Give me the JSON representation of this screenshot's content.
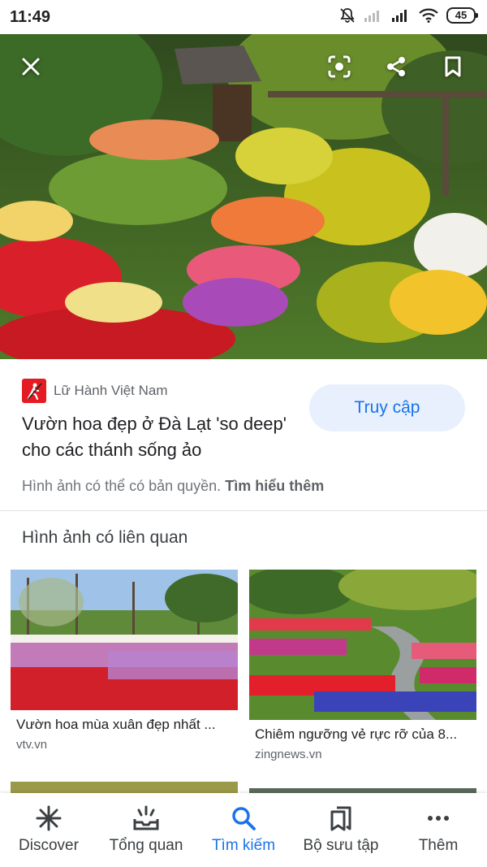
{
  "status_bar": {
    "time": "11:49",
    "battery": "45"
  },
  "hero": {
    "icons": [
      "close-icon",
      "lens-icon",
      "share-icon",
      "bookmark-icon"
    ]
  },
  "source": {
    "site_name": "Lữ Hành Việt Nam",
    "title": "Vườn hoa đẹp ở Đà Lạt 'so deep' cho các thánh sống ảo",
    "visit_label": "Truy cập",
    "copyright_text": "Hình ảnh có thể có bản quyền.",
    "learn_more": "Tìm hiểu thêm"
  },
  "related": {
    "heading": "Hình ảnh có liên quan",
    "items": [
      {
        "caption": "Vườn hoa mùa xuân đẹp nhất ...",
        "source": "vtv.vn"
      },
      {
        "caption": "Chiêm ngưỡng vẻ rực rỡ của 8...",
        "source": "zingnews.vn"
      }
    ]
  },
  "bottom_nav": [
    {
      "label": "Discover",
      "icon": "asterisk-icon"
    },
    {
      "label": "Tổng quan",
      "icon": "updates-icon"
    },
    {
      "label": "Tìm kiếm",
      "icon": "search-icon",
      "active": true
    },
    {
      "label": "Bộ sưu tập",
      "icon": "collections-icon"
    },
    {
      "label": "Thêm",
      "icon": "more-icon"
    }
  ],
  "colors": {
    "accent": "#1a73e8",
    "visit_bg": "#e8f0fe",
    "site_logo": "#e51b23"
  }
}
